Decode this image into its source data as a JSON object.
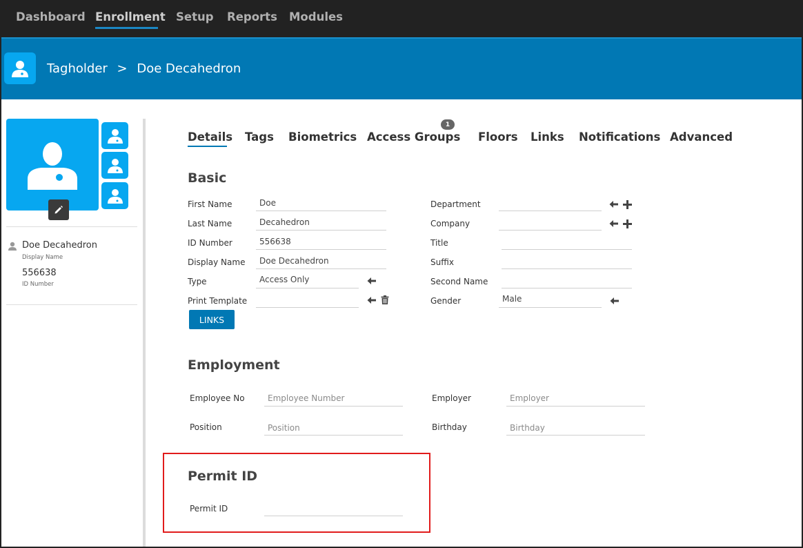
{
  "nav": {
    "items": [
      "Dashboard",
      "Enrollment",
      "Setup",
      "Reports",
      "Modules"
    ],
    "active": "Enrollment"
  },
  "header": {
    "breadcrumb_root": "Tagholder",
    "separator": ">",
    "breadcrumb_current": "Doe Decahedron"
  },
  "profile": {
    "name": "Doe Decahedron",
    "name_caption": "Display Name",
    "id": "556638",
    "id_caption": "ID Number"
  },
  "tabs": {
    "details": "Details",
    "tags": "Tags",
    "biometrics": "Biometrics",
    "access_groups": "Access Groups",
    "access_groups_badge": "1",
    "floors": "Floors",
    "links": "Links",
    "notifications": "Notifications",
    "advanced": "Advanced"
  },
  "basic": {
    "title": "Basic",
    "first_name": {
      "label": "First Name",
      "value": "Doe"
    },
    "last_name": {
      "label": "Last Name",
      "value": "Decahedron"
    },
    "id_number": {
      "label": "ID Number",
      "value": "556638"
    },
    "display_name": {
      "label": "Display Name",
      "value": "Doe Decahedron"
    },
    "type": {
      "label": "Type",
      "value": "Access Only"
    },
    "print_template": {
      "label": "Print Template",
      "value": ""
    },
    "department": {
      "label": "Department",
      "value": ""
    },
    "company": {
      "label": "Company",
      "value": ""
    },
    "title_field": {
      "label": "Title",
      "value": ""
    },
    "suffix": {
      "label": "Suffix",
      "value": ""
    },
    "second_name": {
      "label": "Second Name",
      "value": ""
    },
    "gender": {
      "label": "Gender",
      "value": "Male"
    },
    "links_button": "LINKS"
  },
  "employment": {
    "title": "Employment",
    "employee_no": {
      "label": "Employee No",
      "placeholder": "Employee Number"
    },
    "employer": {
      "label": "Employer",
      "placeholder": "Employer"
    },
    "position": {
      "label": "Position",
      "placeholder": "Position"
    },
    "birthday": {
      "label": "Birthday",
      "placeholder": "Birthday"
    }
  },
  "permit": {
    "title": "Permit ID",
    "permit_id": {
      "label": "Permit ID",
      "value": ""
    }
  },
  "colors": {
    "nav_bg": "#222222",
    "header_bg": "#0178b4",
    "avatar_bg": "#07a7f0",
    "highlight": "#e11b1b"
  },
  "icons": {
    "arrow": "arrow-left-icon",
    "plus": "plus-icon",
    "trash": "trash-icon",
    "edit": "pencil-icon",
    "person": "person-icon"
  }
}
